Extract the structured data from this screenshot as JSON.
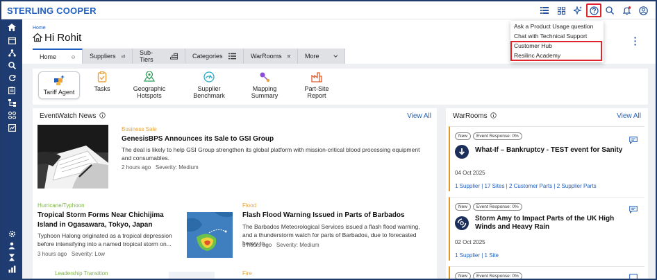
{
  "app": {
    "brand": "STERLING COOPER"
  },
  "topbar_icons": [
    "list-icon",
    "grid-icon",
    "sparkle-icon",
    "help-icon",
    "search-icon",
    "bell-icon",
    "user-icon"
  ],
  "help_menu": {
    "items": [
      {
        "label": "Ask a Product Usage question"
      },
      {
        "label": "Chat with Technical Support"
      },
      {
        "label": "Customer Hub"
      },
      {
        "label": "Resilinc Academy"
      }
    ]
  },
  "header": {
    "breadcrumb": "Home",
    "title": "Hi Rohit"
  },
  "tabs": [
    {
      "label": "Home",
      "icon": "home-icon"
    },
    {
      "label": "Suppliers",
      "icon": "factory-icon"
    },
    {
      "label": "Sub-Tiers",
      "icon": "tiers-icon"
    },
    {
      "label": "Categories",
      "icon": "list-icon"
    },
    {
      "label": "WarRooms",
      "icon": "calendar-icon"
    },
    {
      "label": "More",
      "icon": "chevron-down-icon"
    }
  ],
  "tools": [
    {
      "label": "Tariff Agent"
    },
    {
      "label": "Tasks"
    },
    {
      "label": "Geographic Hotspots"
    },
    {
      "label": "Supplier Benchmark"
    },
    {
      "label": "Mapping Summary"
    },
    {
      "label": "Part-Site Report"
    }
  ],
  "eventwatch": {
    "title": "EventWatch News",
    "view_all": "View All",
    "items": [
      {
        "category": "Business Sale",
        "title": "GenesisBPS Announces its Sale to GSI Group",
        "desc": "The deal is likely to help GSI Group strengthen its global platform with mission-critical blood processing equipment and consumables.",
        "meta": "2 hours ago   Severity: Medium"
      },
      {
        "category": "Hurricane/Typhoon",
        "title": "Tropical Storm Forms Near Chichijima Island in Ogasawara, Tokyo, Japan",
        "desc": "Typhoon Halong originated as a tropical depression before intensifying into a named tropical storm on...",
        "meta": "3 hours ago   Severity: Low"
      },
      {
        "category": "Flood",
        "title": "Flash Flood Warning Issued in Parts of Barbados",
        "desc": "The Barbados Meteorological Services issued a flash flood warning, and a thunderstorm watch for parts of Barbados, due to forecasted heavy to...",
        "meta": "3 hours ago   Severity: Medium"
      },
      {
        "category": "Leadership Transition"
      },
      {
        "category": "Fire"
      }
    ]
  },
  "warrooms": {
    "title": "WarRooms",
    "view_all": "View All",
    "items": [
      {
        "badge_new": "New",
        "badge_response": "Event Response: 0%",
        "title": "What-If – Bankruptcy - TEST event for Sanity",
        "date": "04 Oct 2025",
        "links": "1 Supplier | 17 Sites | 2 Customer Parts | 2 Supplier Parts"
      },
      {
        "badge_new": "New",
        "badge_response": "Event Response: 0%",
        "title": "Storm Amy to Impact Parts of the UK High Winds and Heavy Rain",
        "date": "02 Oct 2025",
        "links": "1 Supplier | 1 Site"
      },
      {
        "badge_new": "New",
        "badge_response": "Event Response: 0%"
      }
    ]
  },
  "colors": {
    "brand_blue": "#1f5fbf",
    "sidebar_navy": "#1e3c72",
    "highlight_red": "#e0242c",
    "category_orange": "#e8a33d",
    "category_green": "#7cb342"
  }
}
